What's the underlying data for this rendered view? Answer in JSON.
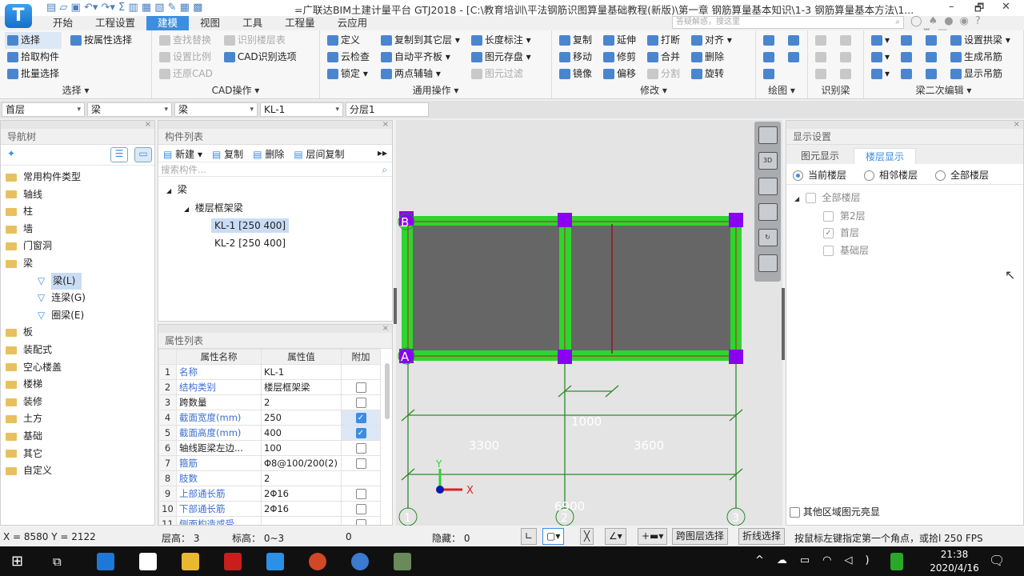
{
  "app": {
    "title": "=广联达BIM土建计量平台 GTJ2018 - [C:\\教育培训\\平法钢筋识图算量基础教程(新版)\\第一章 钢筋算量基本知识\\1-3 钢筋算量基本方法\\1...",
    "logo": "T"
  },
  "quick_access": [
    "file-new-icon",
    "open-icon",
    "save-icon",
    "undo-icon",
    "redo-icon",
    "sum-icon",
    "report-icon",
    "view-icon",
    "calc-icon",
    "pen-icon",
    "grid-icon",
    "export-icon"
  ],
  "tabs": [
    "开始",
    "工程设置",
    "建模",
    "视图",
    "工具",
    "工程量",
    "云应用"
  ],
  "active_tab": "建模",
  "search_placeholder": "答疑解惑，搜这里",
  "ribbon": [
    {
      "label": "选择 ▾",
      "cols": [
        [
          {
            "t": "选择",
            "s": 1
          },
          {
            "t": "拾取构件"
          },
          {
            "t": "批量选择"
          }
        ],
        [
          {
            "t": "按属性选择"
          }
        ]
      ]
    },
    {
      "label": "CAD操作 ▾",
      "cols": [
        [
          {
            "t": "查找替换",
            "d": 1
          },
          {
            "t": "设置比例",
            "d": 1
          },
          {
            "t": "还原CAD",
            "d": 1
          }
        ],
        [
          {
            "t": "识别楼层表",
            "d": 1
          },
          {
            "t": "CAD识别选项"
          }
        ]
      ]
    },
    {
      "label": "通用操作 ▾",
      "cols": [
        [
          {
            "t": "定义"
          },
          {
            "t": "云检查"
          },
          {
            "t": "锁定 ▾"
          }
        ],
        [
          {
            "t": "复制到其它层 ▾"
          },
          {
            "t": "自动平齐板 ▾"
          },
          {
            "t": "两点辅轴 ▾"
          }
        ],
        [
          {
            "t": "长度标注 ▾"
          },
          {
            "t": "图元存盘 ▾"
          },
          {
            "t": "图元过滤",
            "d": 1
          }
        ]
      ]
    },
    {
      "label": "修改 ▾",
      "cols": [
        [
          {
            "t": "复制"
          },
          {
            "t": "移动"
          },
          {
            "t": "镜像"
          }
        ],
        [
          {
            "t": "延伸"
          },
          {
            "t": "修剪"
          },
          {
            "t": "偏移"
          }
        ],
        [
          {
            "t": "打断"
          },
          {
            "t": "合并"
          },
          {
            "t": "分割",
            "d": 1
          }
        ],
        [
          {
            "t": "对齐 ▾"
          },
          {
            "t": "删除"
          },
          {
            "t": "旋转"
          }
        ]
      ]
    },
    {
      "label": "绘图 ▾",
      "cols": [
        [
          {
            "t": ""
          },
          {
            "t": ""
          },
          {
            "t": ""
          }
        ],
        [
          {
            "t": ""
          },
          {
            "t": ""
          }
        ]
      ]
    },
    {
      "label": "识别梁",
      "cols": [
        [
          {
            "t": "",
            "d": 1
          },
          {
            "t": "",
            "d": 1
          },
          {
            "t": "",
            "d": 1
          }
        ],
        [
          {
            "t": "",
            "d": 1
          },
          {
            "t": "",
            "d": 1
          },
          {
            "t": "",
            "d": 1
          }
        ]
      ]
    },
    {
      "label": "梁二次编辑 ▾",
      "cols": [
        [
          {
            "t": "▾"
          },
          {
            "t": "▾"
          },
          {
            "t": "▾"
          }
        ],
        [
          {
            "t": ""
          },
          {
            "t": ""
          },
          {
            "t": ""
          }
        ],
        [
          {
            "t": ""
          },
          {
            "t": ""
          },
          {
            "t": ""
          }
        ],
        [
          {
            "t": "设置拱梁 ▾"
          },
          {
            "t": "生成吊筋"
          },
          {
            "t": "显示吊筋"
          }
        ]
      ]
    }
  ],
  "selectors": [
    "首层",
    "梁",
    "梁",
    "KL-1",
    "分层1"
  ],
  "nav": {
    "title": "导航树",
    "items": [
      "常用构件类型",
      "轴线",
      "柱",
      "墙",
      "门窗洞",
      "梁"
    ],
    "sub": [
      {
        "label": "梁(L)",
        "selected": true
      },
      {
        "label": "连梁(G)"
      },
      {
        "label": "圈梁(E)"
      }
    ],
    "items2": [
      "板",
      "装配式",
      "空心楼盖",
      "楼梯",
      "装修",
      "土方",
      "基础",
      "其它",
      "自定义"
    ]
  },
  "component_list": {
    "title": "构件列表",
    "toolbar": [
      "新建 ▾",
      "复制",
      "删除",
      "层间复制"
    ],
    "search_placeholder": "搜索构件...",
    "root": "梁",
    "group": "楼层框架梁",
    "items": [
      {
        "label": "KL-1 [250 400]",
        "selected": true
      },
      {
        "label": "KL-2 [250 400]"
      }
    ]
  },
  "properties": {
    "title": "属性列表",
    "headers": [
      "属性名称",
      "属性值",
      "附加"
    ],
    "rows": [
      {
        "n": "1",
        "name": "名称",
        "value": "KL-1",
        "blue": true,
        "cb": null
      },
      {
        "n": "2",
        "name": "结构类别",
        "value": "楼层框架梁",
        "blue": true,
        "cb": false
      },
      {
        "n": "3",
        "name": "跨数量",
        "value": "2",
        "blue": false,
        "cb": false
      },
      {
        "n": "4",
        "name": "截面宽度(mm)",
        "value": "250",
        "blue": true,
        "cb": true
      },
      {
        "n": "5",
        "name": "截面高度(mm)",
        "value": "400",
        "blue": true,
        "cb": true
      },
      {
        "n": "6",
        "name": "轴线距梁左边...",
        "value": "100",
        "blue": false,
        "cb": false
      },
      {
        "n": "7",
        "name": "箍筋",
        "value": "Φ8@100/200(2)",
        "blue": true,
        "cb": false
      },
      {
        "n": "8",
        "name": "肢数",
        "value": "2",
        "blue": true,
        "cb": null
      },
      {
        "n": "9",
        "name": "上部通长筋",
        "value": "2Φ16",
        "blue": true,
        "cb": false
      },
      {
        "n": "10",
        "name": "下部通长筋",
        "value": "2Φ16",
        "blue": true,
        "cb": false
      },
      {
        "n": "11",
        "name": "侧面构造或受...",
        "value": "",
        "blue": true,
        "cb": false
      }
    ]
  },
  "drawing": {
    "axes_x": [
      "1",
      "2",
      "3"
    ],
    "axes_y": [
      "A",
      "B"
    ],
    "dims": [
      "3300",
      "3600",
      "1000",
      "6900"
    ],
    "coord_x": "X",
    "coord_y": "Y",
    "colors": {
      "beam": "#2ed52e",
      "column": "#8a00f0",
      "slab": "#666666",
      "axis": "#2a8a2a"
    }
  },
  "view_tools": [
    "orbit-icon",
    "3d-view-icon",
    "box-view-icon",
    "solid-view-icon",
    "rotate-icon",
    "layer-panel-icon"
  ],
  "display": {
    "title": "显示设置",
    "tabs": [
      "图元显示",
      "楼层显示"
    ],
    "active_tab": "楼层显示",
    "radios": [
      {
        "label": "当前楼层",
        "on": true
      },
      {
        "label": "相邻楼层",
        "on": false
      },
      {
        "label": "全部楼层",
        "on": false
      }
    ],
    "tree_root": "全部楼层",
    "floors": [
      {
        "label": "第2层",
        "checked": false
      },
      {
        "label": "首层",
        "checked": true
      },
      {
        "label": "基础层",
        "checked": false
      }
    ],
    "other_highlight": "其他区域图元亮显"
  },
  "status": {
    "coords": "X = 8580 Y = 2122",
    "floor_height": "层高：  3",
    "elevation": "标高：  0~3",
    "zero": "0",
    "hidden": "隐藏：  0",
    "btn_cross": "跨图层选择",
    "btn_poly": "折线选择",
    "hint": "按鼠标左键指定第一个角点，或拾l 250 FPS"
  },
  "taskbar": {
    "time": "21:38",
    "date": "2020/4/16"
  }
}
